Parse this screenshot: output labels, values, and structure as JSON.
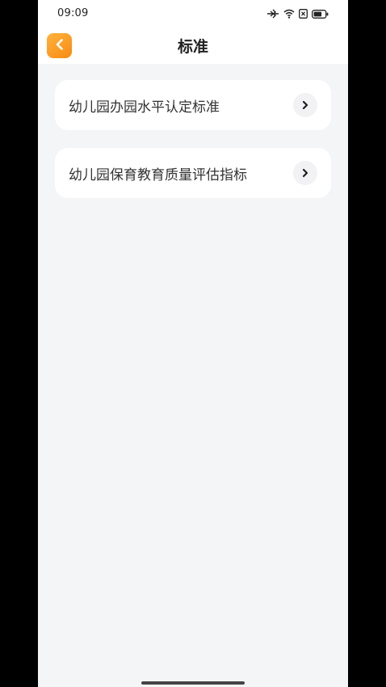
{
  "status_bar": {
    "time": "09:09",
    "icons": [
      "bluetooth-icon",
      "wifi-icon",
      "sim-icon",
      "battery-icon"
    ]
  },
  "header": {
    "title": "标准",
    "back_icon": "chevron-left-icon",
    "back_color": "#f7931e"
  },
  "list": {
    "items": [
      {
        "label": "幼儿园办园水平认定标准",
        "icon": "chevron-right-icon"
      },
      {
        "label": "幼儿园保育教育质量评估指标",
        "icon": "chevron-right-icon"
      }
    ]
  },
  "colors": {
    "background": "#f4f5f7",
    "card": "#ffffff",
    "accent": "#f7931e"
  }
}
